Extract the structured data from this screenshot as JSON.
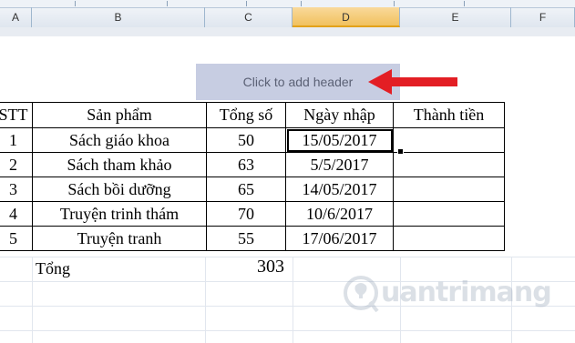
{
  "columns": [
    {
      "letter": "A"
    },
    {
      "letter": "B"
    },
    {
      "letter": "C"
    },
    {
      "letter": "D",
      "selected": true
    },
    {
      "letter": "E"
    },
    {
      "letter": "F"
    }
  ],
  "header_placeholder": "Click to add header",
  "colors": {
    "arrow": "#e31e24",
    "header_bg": "#c7cde2",
    "selected_col": "#f1c15f"
  },
  "table": {
    "headers": [
      "STT",
      "Sản phẩm",
      "Tổng số",
      "Ngày nhập",
      "Thành tiền"
    ],
    "rows": [
      [
        "1",
        "Sách giáo khoa",
        "50",
        "15/05/2017",
        ""
      ],
      [
        "2",
        "Sách tham khảo",
        "63",
        "5/5/2017",
        ""
      ],
      [
        "3",
        "Sách bồi dưỡng",
        "65",
        "14/05/2017",
        ""
      ],
      [
        "4",
        "Truyện trinh thám",
        "70",
        "10/6/2017",
        ""
      ],
      [
        "5",
        "Truyện tranh",
        "55",
        "17/06/2017",
        ""
      ]
    ]
  },
  "total": {
    "label": "Tổng",
    "value": "303"
  },
  "watermark": {
    "text": "uantrimang",
    "icon": "lightbulb-q-icon"
  }
}
